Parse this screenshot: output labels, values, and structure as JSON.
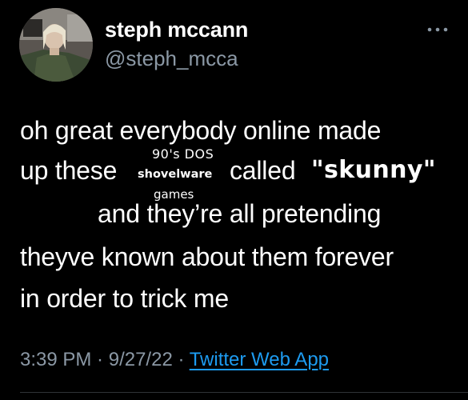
{
  "author": {
    "display_name": "steph mccann",
    "handle": "@steph_mcca"
  },
  "tweet": {
    "line1": "oh great everybody online made",
    "line2_start": "up these",
    "line2_mid": "called",
    "line2_quote": "\"skunny\"",
    "line3": "and they’re all pretending",
    "line4": "theyve known about them forever",
    "line5": "in order to trick me"
  },
  "overlay": {
    "line1": "90's DOS",
    "line2": "shovelware",
    "line3": "games"
  },
  "meta": {
    "time": "3:39 PM",
    "separator1": " · ",
    "date": "9/27/22",
    "separator2": " · ",
    "source": "Twitter Web App"
  },
  "icons": {
    "more": "more-horizontal-icon",
    "avatar": "avatar"
  },
  "colors": {
    "background": "#000000",
    "text": "#ffffff",
    "secondary": "#8b98a5",
    "link": "#1d9bf0"
  }
}
